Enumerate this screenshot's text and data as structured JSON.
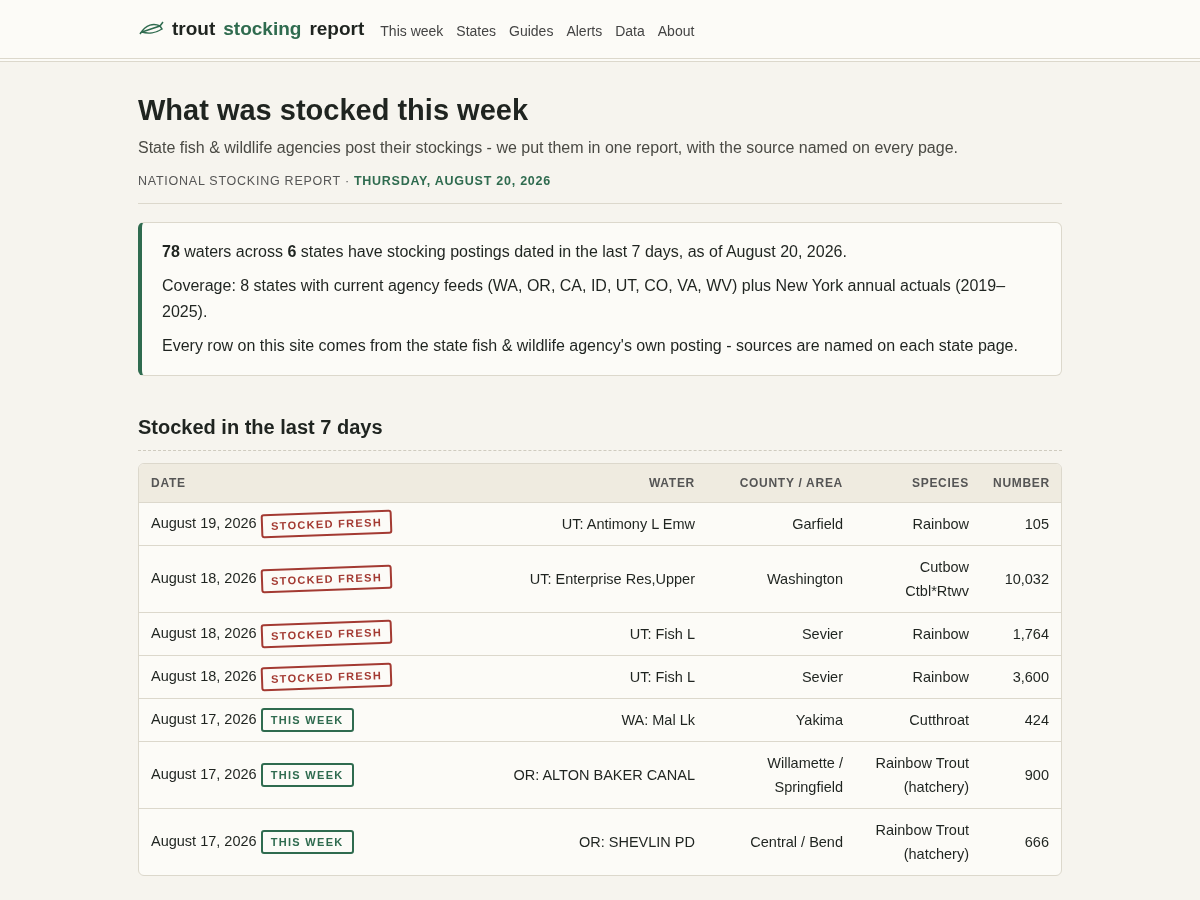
{
  "brand": {
    "parts": [
      "trout",
      "stocking",
      "report"
    ]
  },
  "nav": [
    "This week",
    "States",
    "Guides",
    "Alerts",
    "Data",
    "About"
  ],
  "header": {
    "title": "What was stocked this week",
    "subtitle": "State fish & wildlife agencies post their stockings - we put them in one report, with the source named on every page.",
    "kicker": "NATIONAL STOCKING REPORT ·",
    "date": "THURSDAY, AUGUST 20, 2026"
  },
  "summary": [
    "**78** waters across **6** states have stocking postings dated in the last 7 days, as of August 20, 2026.",
    "Coverage: 8 states with current agency feeds (WA, OR, CA, ID, UT, CO, VA, WV) plus New York annual actuals (2019–2025).",
    "Every row on this site comes from the state fish & wildlife agency's own posting - sources are named on each state page."
  ],
  "section_title": "Stocked in the last 7 days",
  "table": {
    "columns": [
      "DATE",
      "WATER",
      "COUNTY / AREA",
      "SPECIES",
      "NUMBER"
    ],
    "rows": [
      {
        "date": "August 19, 2026",
        "badge": {
          "kind": "fresh",
          "label": "STOCKED FRESH"
        },
        "water": "UT: Antimony L Emw",
        "county": "Garfield",
        "species": "Rainbow",
        "number": "105"
      },
      {
        "date": "August 18, 2026",
        "badge": {
          "kind": "fresh",
          "label": "STOCKED FRESH"
        },
        "water": "UT: Enterprise Res,Upper",
        "county": "Washington",
        "species": "Cutbow Ctbl*Rtwv",
        "number": "10,032"
      },
      {
        "date": "August 18, 2026",
        "badge": {
          "kind": "fresh",
          "label": "STOCKED FRESH"
        },
        "water": "UT: Fish L",
        "county": "Sevier",
        "species": "Rainbow",
        "number": "1,764"
      },
      {
        "date": "August 18, 2026",
        "badge": {
          "kind": "fresh",
          "label": "STOCKED FRESH"
        },
        "water": "UT: Fish L",
        "county": "Sevier",
        "species": "Rainbow",
        "number": "3,600"
      },
      {
        "date": "August 17, 2026",
        "badge": {
          "kind": "week",
          "label": "THIS WEEK"
        },
        "water": "WA: Mal Lk",
        "county": "Yakima",
        "species": "Cutthroat",
        "number": "424"
      },
      {
        "date": "August 17, 2026",
        "badge": {
          "kind": "week",
          "label": "THIS WEEK"
        },
        "water": "OR: ALTON BAKER CANAL",
        "county": "Willamette / Springfield",
        "species": "Rainbow Trout (hatchery)",
        "number": "900"
      },
      {
        "date": "August 17, 2026",
        "badge": {
          "kind": "week",
          "label": "THIS WEEK"
        },
        "water": "OR: SHEVLIN PD",
        "county": "Central / Bend",
        "species": "Rainbow Trout (hatchery)",
        "number": "666"
      }
    ]
  }
}
